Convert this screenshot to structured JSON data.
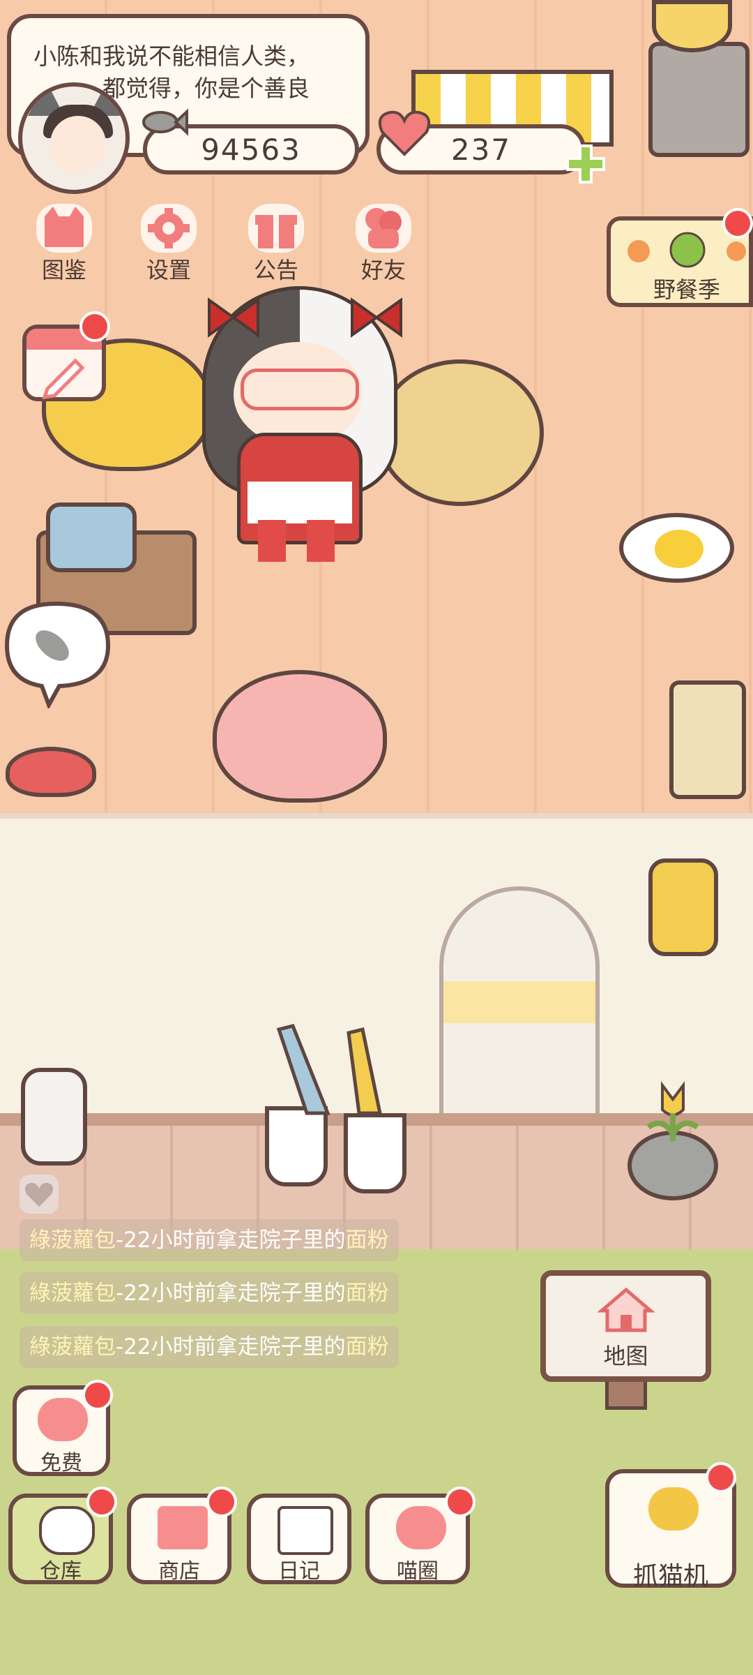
{
  "speech_bubble": {
    "text_line1": "小陈和我说不能相信人类，",
    "text_line2": "　　　都觉得，你是个善良"
  },
  "currency": {
    "coins": "94563",
    "hearts": "237"
  },
  "top_menu": [
    {
      "label": "图鉴",
      "icon": "cat-book-icon"
    },
    {
      "label": "设置",
      "icon": "gear-icon"
    },
    {
      "label": "公告",
      "icon": "gift-icon"
    },
    {
      "label": "好友",
      "icon": "friends-icon"
    }
  ],
  "event": {
    "label": "野餐季"
  },
  "activity_feed": [
    {
      "name": "綠菠蘿包",
      "text": "-22小时前拿走院子里的",
      "item": "面粉"
    },
    {
      "name": "綠菠蘿包",
      "text": "-22小时前拿走院子里的",
      "item": "面粉"
    },
    {
      "name": "綠菠蘿包",
      "text": "-22小时前拿走院子里的",
      "item": "面粉"
    }
  ],
  "map": {
    "label": "地图"
  },
  "free": {
    "label": "免费"
  },
  "bottom_nav": [
    {
      "label": "仓库",
      "icon": "rice-ball-icon"
    },
    {
      "label": "商店",
      "icon": "shop-icon"
    },
    {
      "label": "日记",
      "icon": "diary-icon"
    },
    {
      "label": "喵圈",
      "icon": "cat-planet-icon"
    }
  ],
  "claw_machine": {
    "label": "抓猫机"
  },
  "colors": {
    "badge_red": "#ef4a4a",
    "border_brown": "#6b4a44",
    "feed_name": "#fff3b5"
  }
}
